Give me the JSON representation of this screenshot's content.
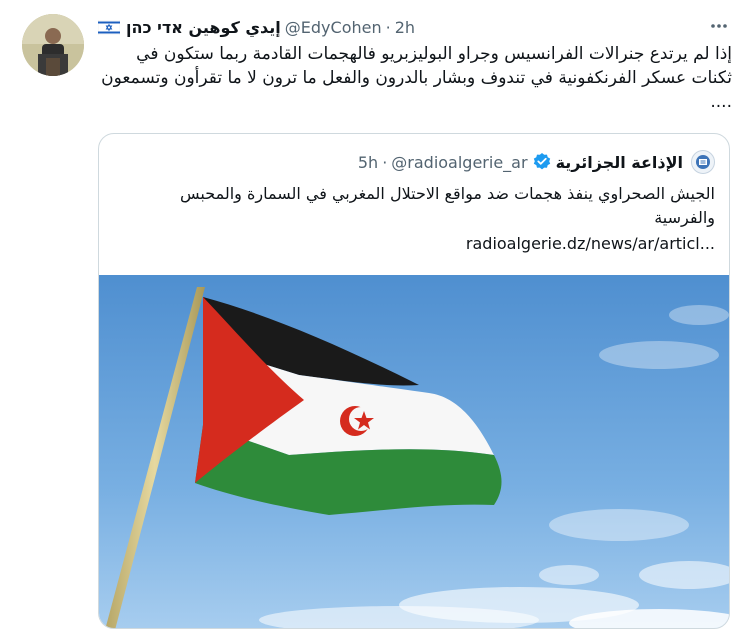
{
  "tweet": {
    "author_name": "إيدي كوهين אדי כהן",
    "handle": "@EdyCohen",
    "separator": "·",
    "time": "2h",
    "more_icon": "more-horizontal-icon",
    "text": "إذا لم يرتدع جنرالات الفرانسيس وجراو البوليزبريو فالهجمات القادمة ربما ستكون في ثكنات عسكر الفرنكفونية في تندوف وبشار بالدرون والفعل ما ترون لا ما تقرأون وتسمعون ...."
  },
  "quote": {
    "author_name": "الإذاعة الجزائرية",
    "handle": "@radioalgerie_ar",
    "separator": "·",
    "time": "5h",
    "verified_icon": "verified-badge-icon",
    "text": "الجيش الصحراوي ينفذ هجمات ضد مواقع الاحتلال المغربي في السمارة والمحبس والفرسية",
    "link": "radioalgerie.dz/news/ar/articl..."
  },
  "colors": {
    "text_primary": "#0f1419",
    "text_secondary": "#536471",
    "border": "#cfd9de",
    "verified": "#1d9bf0",
    "flag_red": "#d52b1e",
    "flag_green": "#2e8b3a",
    "sky": "#5a9ad6"
  }
}
